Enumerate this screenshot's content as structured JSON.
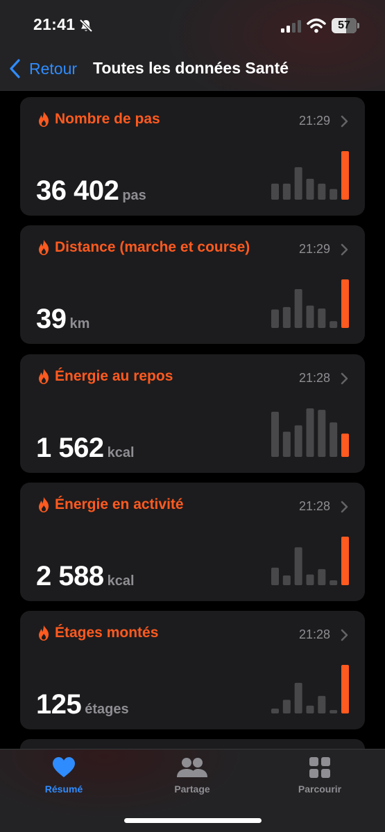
{
  "status_bar": {
    "time": "21:41",
    "battery": "57",
    "battery_level": 0.57
  },
  "nav": {
    "back_label": "Retour",
    "title": "Toutes les données Santé"
  },
  "cards": [
    {
      "title": "Nombre de pas",
      "time": "21:29",
      "value": "36 402",
      "unit": "pas",
      "bars": [
        0.33,
        0.33,
        0.67,
        0.43,
        0.33,
        0.22,
        1.0
      ]
    },
    {
      "title": "Distance (marche et course)",
      "time": "21:29",
      "value": "39",
      "unit": "km",
      "bars": [
        0.38,
        0.43,
        0.8,
        0.46,
        0.4,
        0.14,
        1.0
      ]
    },
    {
      "title": "Énergie au repos",
      "time": "21:28",
      "value": "1 562",
      "unit": "kcal",
      "bars": [
        0.93,
        0.52,
        0.65,
        1.0,
        0.97,
        0.71,
        0.48
      ]
    },
    {
      "title": "Énergie en activité",
      "time": "21:28",
      "value": "2 588",
      "unit": "kcal",
      "bars": [
        0.36,
        0.2,
        0.78,
        0.22,
        0.33,
        0.1,
        1.0
      ]
    },
    {
      "title": "Étages montés",
      "time": "21:28",
      "value": "125",
      "unit": "étages",
      "bars": [
        0.1,
        0.28,
        0.63,
        0.16,
        0.36,
        0.07,
        1.0
      ]
    }
  ],
  "tabs": [
    {
      "label": "Résumé",
      "icon": "heart-icon",
      "active": true
    },
    {
      "label": "Partage",
      "icon": "people-icon",
      "active": false
    },
    {
      "label": "Parcourir",
      "icon": "grid-icon",
      "active": false
    }
  ],
  "colors": {
    "accent": "#ff5a1f",
    "link": "#2f8cff",
    "bar_inactive": "#48484a",
    "card_bg": "#1c1c1e",
    "secondary_text": "#8e8e93"
  }
}
